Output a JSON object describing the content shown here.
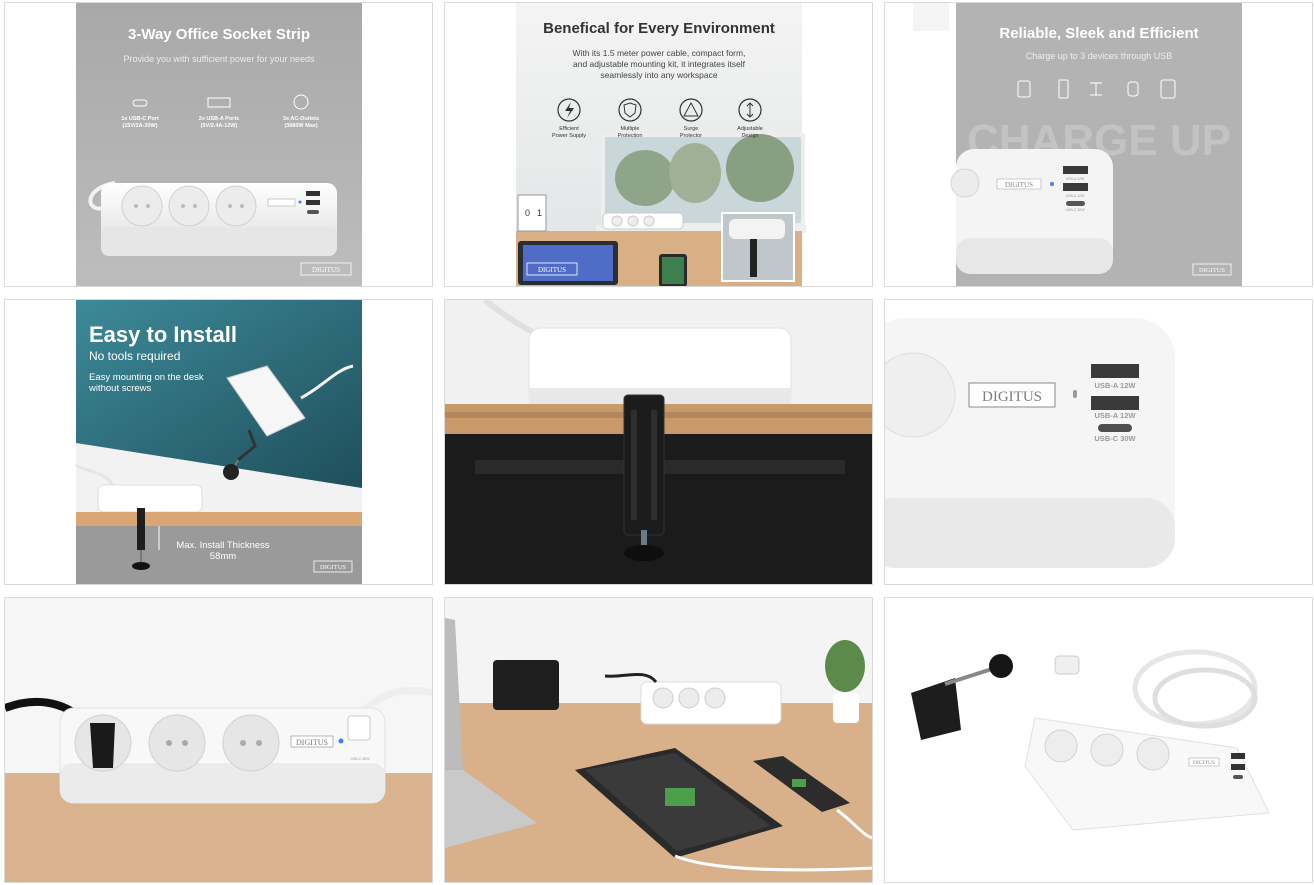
{
  "brand": "DIGITUS",
  "brand_mark": "DIGITUS®",
  "tiles": [
    {
      "title": "3-Way Office Socket Strip",
      "subtitle": "Provide you with sufficient power for your needs",
      "features": [
        {
          "line1": "1x USB-C Port",
          "line2": "(15V/2A-30W)",
          "icon": "usb-c-port-icon"
        },
        {
          "line1": "2x USB-A Ports",
          "line2": "(5V/2.4A-12W)",
          "icon": "usb-a-port-icon"
        },
        {
          "line1": "3x AC-Outlets",
          "line2": "(3680W Max)",
          "icon": "ac-outlet-icon"
        }
      ]
    },
    {
      "title": "Benefical for Every Environment",
      "body_lines": [
        "With its 1.5 meter power cable, compact form,",
        "and adjustable mounting kit, it integrates itself",
        "seamlessly into any workspace"
      ],
      "benefits": [
        {
          "line1": "Efficient",
          "line2": "Power Supply",
          "icon": "lightning-icon"
        },
        {
          "line1": "Multiple",
          "line2": "Protection",
          "icon": "shield-icon"
        },
        {
          "line1": "Surge",
          "line2": "Protector",
          "icon": "surge-warning-icon"
        },
        {
          "line1": "Adjustable",
          "line2": "Design",
          "icon": "adjust-arrows-icon"
        }
      ],
      "calendar_digits": [
        "0",
        "1"
      ]
    },
    {
      "title": "Reliable, Sleek and Efficient",
      "subtitle": "Charge up to 3 devices through USB",
      "watermark": "CHARGE UP",
      "device_icons": [
        "earbuds-icon",
        "phone-icon",
        "drone-icon",
        "watch-icon",
        "tablet-icon"
      ],
      "port_labels": [
        "USB-A 12W",
        "USB-A 12W",
        "USB-C 30W"
      ]
    },
    {
      "title": "Easy to Install",
      "subtitle": "No tools required",
      "body_lines": [
        "Easy mounting on the desk",
        "without screws"
      ],
      "thickness_lines": [
        "Max. Install Thickness",
        "58mm"
      ]
    },
    {
      "alt": "Desk clamp mounted under table edge"
    },
    {
      "port_labels": [
        "USB-A 12W",
        "USB-A 12W",
        "USB-C 30W"
      ]
    },
    {
      "port_labels": [
        "USB-C 30W"
      ]
    },
    {
      "alt": "Socket strip on desk charging laptop, tablet and phone"
    },
    {
      "alt": "Socket strip with desk clamp and cable"
    }
  ],
  "colors": {
    "grey_panel": "#a9a9a9",
    "teal": "#2f6f80",
    "wood": "#d9a773",
    "strip_white": "#f4f4f4",
    "led_blue": "#4a7bff"
  }
}
